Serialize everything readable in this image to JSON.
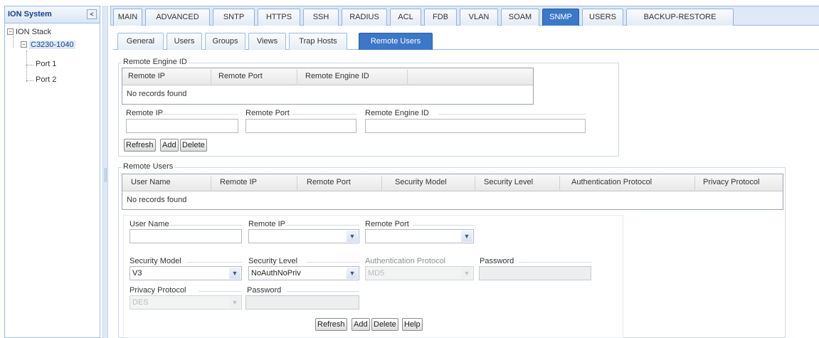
{
  "tree": {
    "title": "ION System",
    "collapse_glyph": "<",
    "root": "ION Stack",
    "root_toggle": "−",
    "device": "C3230-1040",
    "device_toggle": "−",
    "ports": [
      "Port 1",
      "Port 2"
    ]
  },
  "main_tabs": [
    "MAIN",
    "ADVANCED",
    "SNTP",
    "HTTPS",
    "SSH",
    "RADIUS",
    "ACL",
    "FDB",
    "VLAN",
    "SOAM",
    "SNMP",
    "USERS",
    "BACKUP-RESTORE"
  ],
  "main_tab_active": "SNMP",
  "sub_tabs": [
    "General",
    "Users",
    "Groups",
    "Views",
    "Trap Hosts",
    "Remote Users"
  ],
  "sub_tab_active": "Remote Users",
  "engine": {
    "legend": "Remote Engine ID",
    "columns": [
      "Remote IP",
      "Remote Port",
      "Remote Engine ID"
    ],
    "empty": "No records found",
    "fields": {
      "remote_ip": {
        "label": "Remote IP",
        "value": ""
      },
      "remote_port": {
        "label": "Remote Port",
        "value": ""
      },
      "remote_engine_id": {
        "label": "Remote Engine ID",
        "value": ""
      }
    },
    "buttons": {
      "refresh": "Refresh",
      "add": "Add",
      "delete": "Delete"
    }
  },
  "users": {
    "legend": "Remote Users",
    "columns": [
      "User Name",
      "Remote IP",
      "Remote Port",
      "Security Model",
      "Security Level",
      "Authentication Protocol",
      "Privacy Protocol"
    ],
    "empty": "No records found",
    "fields": {
      "user_name": {
        "label": "User Name",
        "value": ""
      },
      "remote_ip": {
        "label": "Remote IP",
        "value": ""
      },
      "remote_port": {
        "label": "Remote Port",
        "value": ""
      },
      "security_model": {
        "label": "Security Model",
        "value": "V3"
      },
      "security_level": {
        "label": "Security Level",
        "value": "NoAuthNoPriv"
      },
      "auth_protocol": {
        "label": "Authentication Protocol",
        "value": "MD5"
      },
      "auth_password": {
        "label": "Password",
        "value": ""
      },
      "privacy_protocol": {
        "label": "Privacy Protocol",
        "value": "DES"
      },
      "privacy_password": {
        "label": "Password",
        "value": ""
      }
    },
    "buttons": {
      "refresh": "Refresh",
      "add": "Add",
      "delete": "Delete",
      "help": "Help"
    }
  },
  "colors": {
    "accent": "#3c78c8",
    "panel_border": "#99bbe8",
    "header_bg": "#dfe8f6"
  }
}
